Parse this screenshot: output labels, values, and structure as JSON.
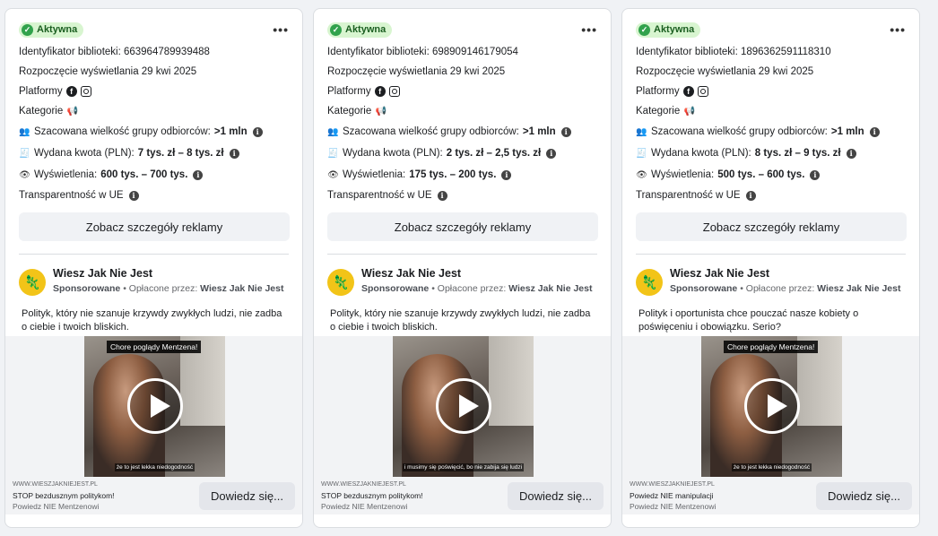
{
  "cards": [
    {
      "status": "Aktywna",
      "library_id": "Identyfikator biblioteki: 663964789939488",
      "start": "Rozpoczęcie wyświetlania 29 kwi 2025",
      "platforms_label": "Platformy",
      "categories_label": "Kategorie",
      "audience_label": "Szacowana wielkość grupy odbiorców:",
      "audience_value": ">1 mln",
      "spend_label": "Wydana kwota (PLN):",
      "spend_value": "7 tys. zł – 8 tys. zł",
      "views_label": "Wyświetlenia:",
      "views_value": "600 tys. – 700 tys.",
      "transparency": "Transparentność w UE",
      "details_button": "Zobacz szczegóły reklamy",
      "advertiser": "Wiesz Jak Nie Jest",
      "sponsored": "Sponsorowane",
      "paid_by_label": "• Opłacone przez:",
      "paid_by": "Wiesz Jak Nie Jest",
      "ad_text": "Polityk, który nie szanuje krzywdy zwykłych ludzi, nie zadba o ciebie i twoich bliskich.",
      "video_caption_top": "Chore poglądy Mentzena!",
      "video_caption_bottom": "że to jest lekka niedogodność",
      "footer_url": "WWW.WIESZJAKNIEJEST.PL",
      "footer_title": "STOP bezdusznym politykom!",
      "footer_desc": "Powiedz NIE Mentzenowi",
      "cta": "Dowiedz się..."
    },
    {
      "status": "Aktywna",
      "library_id": "Identyfikator biblioteki: 698909146179054",
      "start": "Rozpoczęcie wyświetlania 29 kwi 2025",
      "platforms_label": "Platformy",
      "categories_label": "Kategorie",
      "audience_label": "Szacowana wielkość grupy odbiorców:",
      "audience_value": ">1 mln",
      "spend_label": "Wydana kwota (PLN):",
      "spend_value": "2 tys. zł – 2,5 tys. zł",
      "views_label": "Wyświetlenia:",
      "views_value": "175 tys. – 200 tys.",
      "transparency": "Transparentność w UE",
      "details_button": "Zobacz szczegóły reklamy",
      "advertiser": "Wiesz Jak Nie Jest",
      "sponsored": "Sponsorowane",
      "paid_by_label": "• Opłacone przez:",
      "paid_by": "Wiesz Jak Nie Jest",
      "ad_text": "Polityk, który nie szanuje krzywdy zwykłych ludzi, nie zadba o ciebie i twoich bliskich.",
      "video_caption_top": "",
      "video_caption_bottom": "i musimy się poświęcić, bo nie zabija się ludzi",
      "footer_url": "WWW.WIESZJAKNIEJEST.PL",
      "footer_title": "STOP bezdusznym politykom!",
      "footer_desc": "Powiedz NIE Mentzenowi",
      "cta": "Dowiedz się..."
    },
    {
      "status": "Aktywna",
      "library_id": "Identyfikator biblioteki: 1896362591118310",
      "start": "Rozpoczęcie wyświetlania 29 kwi 2025",
      "platforms_label": "Platformy",
      "categories_label": "Kategorie",
      "audience_label": "Szacowana wielkość grupy odbiorców:",
      "audience_value": ">1 mln",
      "spend_label": "Wydana kwota (PLN):",
      "spend_value": "8 tys. zł – 9 tys. zł",
      "views_label": "Wyświetlenia:",
      "views_value": "500 tys. – 600 tys.",
      "transparency": "Transparentność w UE",
      "details_button": "Zobacz szczegóły reklamy",
      "advertiser": "Wiesz Jak Nie Jest",
      "sponsored": "Sponsorowane",
      "paid_by_label": "• Opłacone przez:",
      "paid_by": "Wiesz Jak Nie Jest",
      "ad_text": "Polityk i oportunista chce pouczać nasze kobiety o poświęceniu i obowiązku. Serio?",
      "video_caption_top": "Chore poglądy Mentzena!",
      "video_caption_bottom": "że to jest lekka niedogodność",
      "footer_url": "WWW.WIESZJAKNIEJEST.PL",
      "footer_title": "Powiedz NIE manipulacji",
      "footer_desc": "Powiedz NIE Mentzenowi",
      "cta": "Dowiedz się..."
    }
  ],
  "icons": {
    "status": "check-circle-icon",
    "menu": "more-horizontal-icon",
    "facebook": "facebook-icon",
    "instagram": "instagram-icon",
    "category": "megaphone-icon",
    "audience": "people-icon",
    "spend": "receipt-icon",
    "views": "eye-icon",
    "info": "info-icon"
  },
  "colors": {
    "active_badge_bg": "#d8f5d0",
    "active_check": "#31a24c",
    "avatar": "#f2c418"
  }
}
